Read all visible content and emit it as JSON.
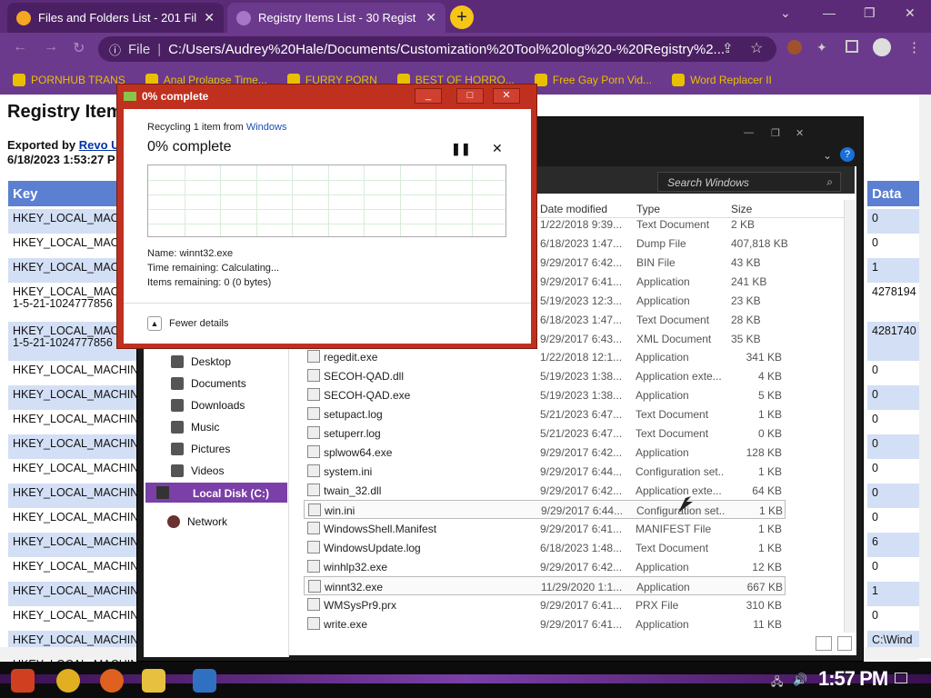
{
  "browser": {
    "tabs": [
      {
        "label": "Files and Folders List - 201 Fil",
        "active": false
      },
      {
        "label": "Registry Items List - 30 Regist",
        "active": true
      }
    ],
    "address": "C:/Users/Audrey%20Hale/Documents/Customization%20Tool%20log%20-%20Registry%2...",
    "file_label": "File",
    "bookmarks": [
      "PORNHUB TRANS",
      "Anal Prolapse Time...",
      "FURRY PORN",
      "BEST OF HORRO...",
      "Free Gay Porn Vid...",
      "Word Replacer II"
    ]
  },
  "page": {
    "title": "Registry Items",
    "exported_by_label": "Exported by",
    "exported_by_link": "Revo U",
    "export_date": "6/18/2023 1:53:27 P",
    "key_header": "Key",
    "data_header": "Data",
    "keys": [
      "HKEY_LOCAL_MACHINE",
      "HKEY_LOCAL_MACHINE",
      "HKEY_LOCAL_MACHINE",
      "HKEY_LOCAL_MACHINE\n1-5-21-1024777856",
      "HKEY_LOCAL_MACHINE\n1-5-21-1024777856",
      "HKEY_LOCAL_MACHINE",
      "HKEY_LOCAL_MACHINE",
      "HKEY_LOCAL_MACHINE",
      "HKEY_LOCAL_MACHINE",
      "HKEY_LOCAL_MACHINE",
      "HKEY_LOCAL_MACHINE",
      "HKEY_LOCAL_MACHINE",
      "HKEY_LOCAL_MACHINE",
      "HKEY_LOCAL_MACHINE",
      "HKEY_LOCAL_MACHINE",
      "HKEY_LOCAL_MACHINE",
      "HKEY_LOCAL_MACHINE",
      "HKEY_LOCAL_MACHINE"
    ],
    "data": [
      "0",
      "0",
      "1",
      "4278194",
      "4281740",
      "0",
      "0",
      "0",
      "0",
      "0",
      "0",
      "0",
      "6",
      "0",
      "1",
      "0",
      "C:\\Wind"
    ]
  },
  "explorer": {
    "search_placeholder": "Search Windows",
    "columns": {
      "date": "Date modified",
      "type": "Type",
      "size": "Size"
    },
    "nav": [
      "Desktop",
      "Documents",
      "Downloads",
      "Music",
      "Pictures",
      "Videos",
      "Local Disk (C:)",
      "Network"
    ],
    "partial_files": [
      {
        "date": "1/22/2018 9:39...",
        "type": "Text Document",
        "size": "2 KB"
      },
      {
        "date": "6/18/2023 1:47...",
        "type": "Dump File",
        "size": "407,818 KB"
      },
      {
        "date": "9/29/2017 6:42...",
        "type": "BIN File",
        "size": "43 KB"
      },
      {
        "date": "9/29/2017 6:41...",
        "type": "Application",
        "size": "241 KB"
      },
      {
        "date": "5/19/2023 12:3...",
        "type": "Application",
        "size": "23 KB"
      },
      {
        "date": "6/18/2023 1:47...",
        "type": "Text Document",
        "size": "28 KB"
      },
      {
        "date": "9/29/2017 6:43...",
        "type": "XML Document",
        "size": "35 KB"
      }
    ],
    "files": [
      {
        "name": "regedit.exe",
        "date": "1/22/2018 12:1...",
        "type": "Application",
        "size": "341 KB"
      },
      {
        "name": "SECOH-QAD.dll",
        "date": "5/19/2023 1:38...",
        "type": "Application exte...",
        "size": "4 KB"
      },
      {
        "name": "SECOH-QAD.exe",
        "date": "5/19/2023 1:38...",
        "type": "Application",
        "size": "5 KB"
      },
      {
        "name": "setupact.log",
        "date": "5/21/2023 6:47...",
        "type": "Text Document",
        "size": "1 KB"
      },
      {
        "name": "setuperr.log",
        "date": "5/21/2023 6:47...",
        "type": "Text Document",
        "size": "0 KB"
      },
      {
        "name": "splwow64.exe",
        "date": "9/29/2017 6:42...",
        "type": "Application",
        "size": "128 KB"
      },
      {
        "name": "system.ini",
        "date": "9/29/2017 6:44...",
        "type": "Configuration set...",
        "size": "1 KB"
      },
      {
        "name": "twain_32.dll",
        "date": "9/29/2017 6:42...",
        "type": "Application exte...",
        "size": "64 KB"
      },
      {
        "name": "win.ini",
        "date": "9/29/2017 6:44...",
        "type": "Configuration set...",
        "size": "1 KB"
      },
      {
        "name": "WindowsShell.Manifest",
        "date": "9/29/2017 6:41...",
        "type": "MANIFEST File",
        "size": "1 KB"
      },
      {
        "name": "WindowsUpdate.log",
        "date": "6/18/2023 1:48...",
        "type": "Text Document",
        "size": "1 KB"
      },
      {
        "name": "winhlp32.exe",
        "date": "9/29/2017 6:42...",
        "type": "Application",
        "size": "12 KB"
      },
      {
        "name": "winnt32.exe",
        "date": "11/29/2020 1:1...",
        "type": "Application",
        "size": "667 KB"
      },
      {
        "name": "WMSysPr9.prx",
        "date": "9/29/2017 6:41...",
        "type": "PRX File",
        "size": "310 KB"
      },
      {
        "name": "write.exe",
        "date": "9/29/2017 6:41...",
        "type": "Application",
        "size": "11 KB"
      }
    ]
  },
  "dialog": {
    "title": "0% complete",
    "recycling": "Recycling 1 item from",
    "source_link": "Windows",
    "percent": "0% complete",
    "progress": 0,
    "name_line": "Name: winnt32.exe",
    "time_line": "Time remaining: Calculating...",
    "items_line": "Items remaining: 0 (0 bytes)",
    "fewer_details": "Fewer details"
  },
  "taskbar": {
    "clock": "1:57 PM"
  }
}
